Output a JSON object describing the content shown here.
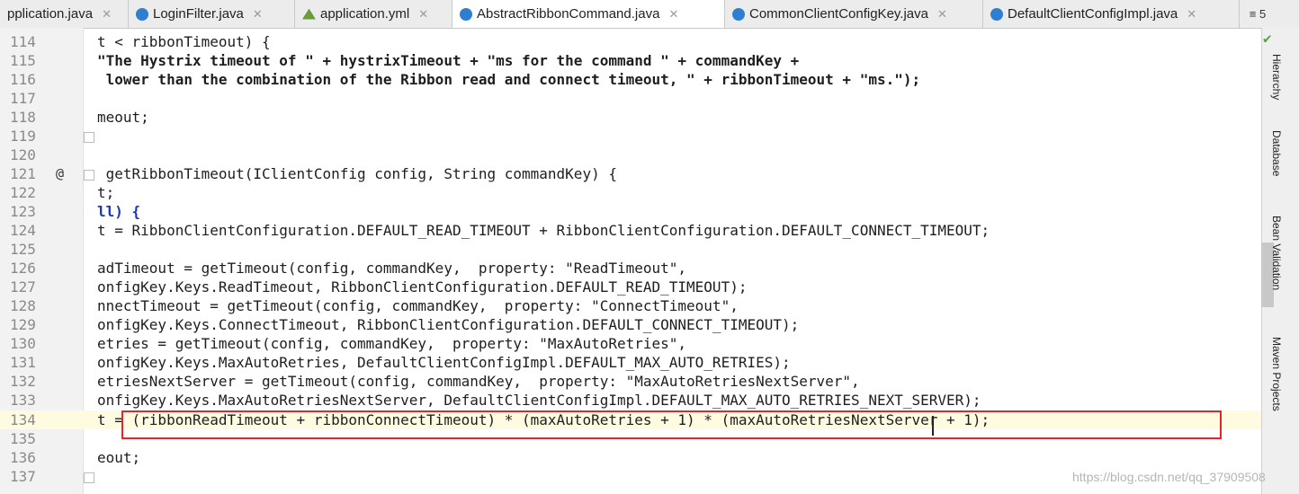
{
  "tabs": [
    {
      "label": "pplication.java",
      "icon": "java-class-icon",
      "active": false
    },
    {
      "label": "LoginFilter.java",
      "icon": "java-class-icon",
      "active": false
    },
    {
      "label": "application.yml",
      "icon": "yml-file-icon",
      "active": false
    },
    {
      "label": "AbstractRibbonCommand.java",
      "icon": "java-class-icon",
      "active": true
    },
    {
      "label": "CommonClientConfigKey.java",
      "icon": "java-class-icon",
      "active": false
    },
    {
      "label": "DefaultClientConfigImpl.java",
      "icon": "java-class-icon",
      "active": false
    }
  ],
  "overflow_label": "≡ 5",
  "right_tools": [
    "Hierarchy",
    "Database",
    "Bean Validation",
    "Maven Projects"
  ],
  "code_lines": [
    {
      "num": "114",
      "text": "t < ribbonTimeout) {"
    },
    {
      "num": "115",
      "text": "\"The Hystrix timeout of \" + hystrixTimeout + \"ms for the command \" + commandKey +"
    },
    {
      "num": "116",
      "text": " lower than the combination of the Ribbon read and connect timeout, \" + ribbonTimeout + \"ms.\");"
    },
    {
      "num": "117",
      "text": ""
    },
    {
      "num": "118",
      "text": "meout;"
    },
    {
      "num": "119",
      "text": ""
    },
    {
      "num": "120",
      "text": ""
    },
    {
      "num": "121",
      "text": " getRibbonTimeout(IClientConfig config, String commandKey) {"
    },
    {
      "num": "122",
      "text": "t;"
    },
    {
      "num": "123",
      "text": "ll) {"
    },
    {
      "num": "124",
      "text": "t = RibbonClientConfiguration.DEFAULT_READ_TIMEOUT + RibbonClientConfiguration.DEFAULT_CONNECT_TIMEOUT;"
    },
    {
      "num": "125",
      "text": ""
    },
    {
      "num": "126",
      "text": "adTimeout = getTimeout(config, commandKey,  property: \"ReadTimeout\","
    },
    {
      "num": "127",
      "text": "onfigKey.Keys.ReadTimeout, RibbonClientConfiguration.DEFAULT_READ_TIMEOUT);"
    },
    {
      "num": "128",
      "text": "nnectTimeout = getTimeout(config, commandKey,  property: \"ConnectTimeout\","
    },
    {
      "num": "129",
      "text": "onfigKey.Keys.ConnectTimeout, RibbonClientConfiguration.DEFAULT_CONNECT_TIMEOUT);"
    },
    {
      "num": "130",
      "text": "etries = getTimeout(config, commandKey,  property: \"MaxAutoRetries\","
    },
    {
      "num": "131",
      "text": "onfigKey.Keys.MaxAutoRetries, DefaultClientConfigImpl.DEFAULT_MAX_AUTO_RETRIES);"
    },
    {
      "num": "132",
      "text": "etriesNextServer = getTimeout(config, commandKey,  property: \"MaxAutoRetriesNextServer\","
    },
    {
      "num": "133",
      "text": "onfigKey.Keys.MaxAutoRetriesNextServer, DefaultClientConfigImpl.DEFAULT_MAX_AUTO_RETRIES_NEXT_SERVER);"
    },
    {
      "num": "134",
      "text": "t = (ribbonReadTimeout + ribbonConnectTimeout) * (maxAutoRetries + 1) * (maxAutoRetriesNextServer + 1);"
    },
    {
      "num": "135",
      "text": ""
    },
    {
      "num": "136",
      "text": "eout;"
    },
    {
      "num": "137",
      "text": ""
    }
  ],
  "watermark": "https://blog.csdn.net/qq_37909508",
  "colors": {
    "string": "#1a7f1a",
    "constant": "#7a1fa2",
    "highlight_box": "#e0262f",
    "gutter": "#f2f2f2"
  }
}
